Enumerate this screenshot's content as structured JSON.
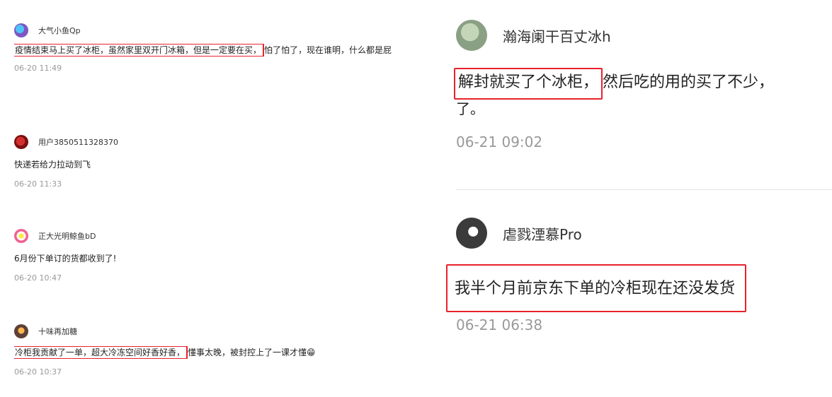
{
  "left": {
    "comments": [
      {
        "user": "大气小鱼Qp",
        "text_highlight": "疫情结束马上买了冰柜，虽然家里双开门冰箱，但是一定要在买，",
        "text_rest": "怕了怕了，现在谁明，什么都是屁",
        "time": "06-20 11:49"
      },
      {
        "user": "用户3850511328370",
        "text": "快递若给力拉动到飞",
        "time": "06-20 11:33"
      },
      {
        "user": "正大光明鲸鱼bD",
        "text": "6月份下单订的货都收到了!",
        "time": "06-20 10:47"
      },
      {
        "user": "十味再加糖",
        "text_highlight": "冷柜我贡献了一单，超大冷冻空间好香好香，",
        "text_rest": "懂事太晚，被封控上了一课才懂😁",
        "time": "06-20 10:37"
      }
    ]
  },
  "right": {
    "comments": [
      {
        "user": "瀚海阑干百丈冰h",
        "text_highlight": "解封就买了个冰柜，",
        "text_rest": "然后吃的用的买了不少，",
        "text_line2": "了。",
        "time": "06-21 09:02"
      },
      {
        "user": "虐戮湮慕Pro",
        "text_highlight": "我半个月前京东下单的冷柜现在还没发货",
        "time": "06-21 06:38"
      }
    ]
  }
}
